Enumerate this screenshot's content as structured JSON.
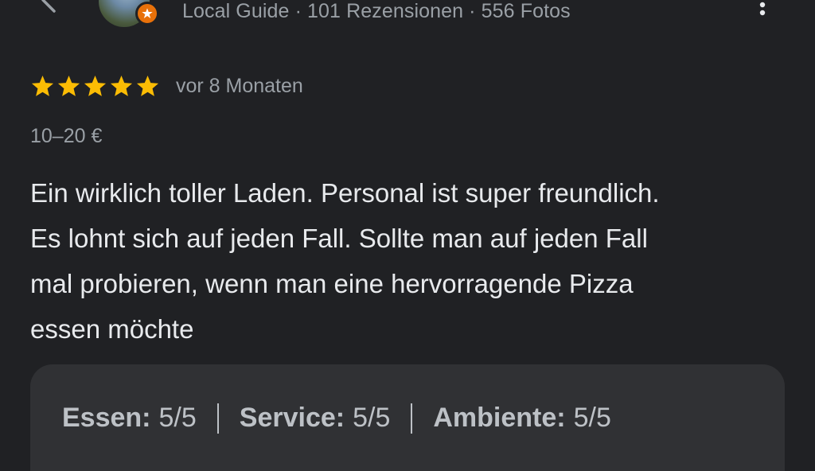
{
  "header": {
    "meta_text": "Local Guide · 101 Rezensionen · 556 Fotos",
    "back_icon": "chevron-left-icon",
    "more_icon": "more-vert-icon",
    "badge_icon": "local-guide-star-icon",
    "badge_color": "#e8710a"
  },
  "review": {
    "stars": 5,
    "max_stars": 5,
    "star_color": "#fbbc04",
    "date": "vor 8 Monaten",
    "price": "10–20 €",
    "text_lines": [
      "Ein wirklich toller Laden. Personal ist super freundlich.",
      "Es lohnt sich auf jeden Fall. Sollte man auf jeden Fall",
      "mal probieren, wenn man eine hervorragende Pizza",
      "essen möchte"
    ]
  },
  "sub_ratings": {
    "food_label": "Essen:",
    "food_value": "5/5",
    "service_label": "Service:",
    "service_value": "5/5",
    "ambience_label": "Ambiente:",
    "ambience_value": "5/5"
  }
}
